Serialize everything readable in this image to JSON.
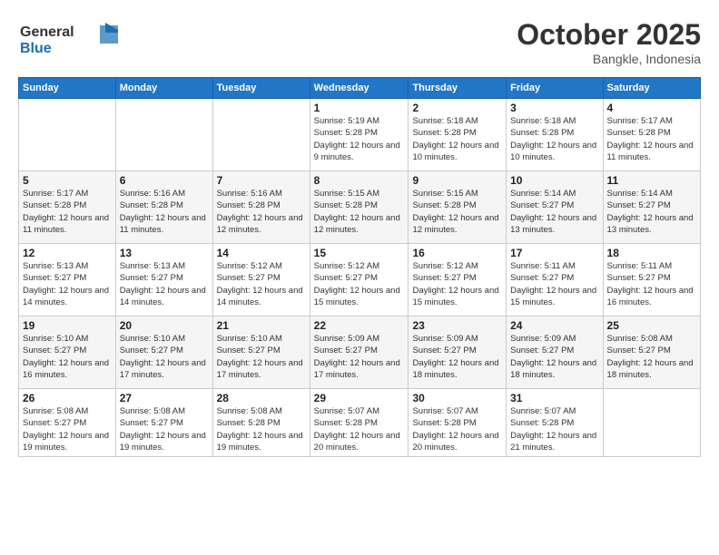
{
  "logo": {
    "line1": "General",
    "line2": "Blue"
  },
  "title": "October 2025",
  "location": "Bangkle, Indonesia",
  "days_header": [
    "Sunday",
    "Monday",
    "Tuesday",
    "Wednesday",
    "Thursday",
    "Friday",
    "Saturday"
  ],
  "weeks": [
    [
      {
        "day": "",
        "info": ""
      },
      {
        "day": "",
        "info": ""
      },
      {
        "day": "",
        "info": ""
      },
      {
        "day": "1",
        "info": "Sunrise: 5:19 AM\nSunset: 5:28 PM\nDaylight: 12 hours\nand 9 minutes."
      },
      {
        "day": "2",
        "info": "Sunrise: 5:18 AM\nSunset: 5:28 PM\nDaylight: 12 hours\nand 10 minutes."
      },
      {
        "day": "3",
        "info": "Sunrise: 5:18 AM\nSunset: 5:28 PM\nDaylight: 12 hours\nand 10 minutes."
      },
      {
        "day": "4",
        "info": "Sunrise: 5:17 AM\nSunset: 5:28 PM\nDaylight: 12 hours\nand 11 minutes."
      }
    ],
    [
      {
        "day": "5",
        "info": "Sunrise: 5:17 AM\nSunset: 5:28 PM\nDaylight: 12 hours\nand 11 minutes."
      },
      {
        "day": "6",
        "info": "Sunrise: 5:16 AM\nSunset: 5:28 PM\nDaylight: 12 hours\nand 11 minutes."
      },
      {
        "day": "7",
        "info": "Sunrise: 5:16 AM\nSunset: 5:28 PM\nDaylight: 12 hours\nand 12 minutes."
      },
      {
        "day": "8",
        "info": "Sunrise: 5:15 AM\nSunset: 5:28 PM\nDaylight: 12 hours\nand 12 minutes."
      },
      {
        "day": "9",
        "info": "Sunrise: 5:15 AM\nSunset: 5:28 PM\nDaylight: 12 hours\nand 12 minutes."
      },
      {
        "day": "10",
        "info": "Sunrise: 5:14 AM\nSunset: 5:27 PM\nDaylight: 12 hours\nand 13 minutes."
      },
      {
        "day": "11",
        "info": "Sunrise: 5:14 AM\nSunset: 5:27 PM\nDaylight: 12 hours\nand 13 minutes."
      }
    ],
    [
      {
        "day": "12",
        "info": "Sunrise: 5:13 AM\nSunset: 5:27 PM\nDaylight: 12 hours\nand 14 minutes."
      },
      {
        "day": "13",
        "info": "Sunrise: 5:13 AM\nSunset: 5:27 PM\nDaylight: 12 hours\nand 14 minutes."
      },
      {
        "day": "14",
        "info": "Sunrise: 5:12 AM\nSunset: 5:27 PM\nDaylight: 12 hours\nand 14 minutes."
      },
      {
        "day": "15",
        "info": "Sunrise: 5:12 AM\nSunset: 5:27 PM\nDaylight: 12 hours\nand 15 minutes."
      },
      {
        "day": "16",
        "info": "Sunrise: 5:12 AM\nSunset: 5:27 PM\nDaylight: 12 hours\nand 15 minutes."
      },
      {
        "day": "17",
        "info": "Sunrise: 5:11 AM\nSunset: 5:27 PM\nDaylight: 12 hours\nand 15 minutes."
      },
      {
        "day": "18",
        "info": "Sunrise: 5:11 AM\nSunset: 5:27 PM\nDaylight: 12 hours\nand 16 minutes."
      }
    ],
    [
      {
        "day": "19",
        "info": "Sunrise: 5:10 AM\nSunset: 5:27 PM\nDaylight: 12 hours\nand 16 minutes."
      },
      {
        "day": "20",
        "info": "Sunrise: 5:10 AM\nSunset: 5:27 PM\nDaylight: 12 hours\nand 17 minutes."
      },
      {
        "day": "21",
        "info": "Sunrise: 5:10 AM\nSunset: 5:27 PM\nDaylight: 12 hours\nand 17 minutes."
      },
      {
        "day": "22",
        "info": "Sunrise: 5:09 AM\nSunset: 5:27 PM\nDaylight: 12 hours\nand 17 minutes."
      },
      {
        "day": "23",
        "info": "Sunrise: 5:09 AM\nSunset: 5:27 PM\nDaylight: 12 hours\nand 18 minutes."
      },
      {
        "day": "24",
        "info": "Sunrise: 5:09 AM\nSunset: 5:27 PM\nDaylight: 12 hours\nand 18 minutes."
      },
      {
        "day": "25",
        "info": "Sunrise: 5:08 AM\nSunset: 5:27 PM\nDaylight: 12 hours\nand 18 minutes."
      }
    ],
    [
      {
        "day": "26",
        "info": "Sunrise: 5:08 AM\nSunset: 5:27 PM\nDaylight: 12 hours\nand 19 minutes."
      },
      {
        "day": "27",
        "info": "Sunrise: 5:08 AM\nSunset: 5:27 PM\nDaylight: 12 hours\nand 19 minutes."
      },
      {
        "day": "28",
        "info": "Sunrise: 5:08 AM\nSunset: 5:28 PM\nDaylight: 12 hours\nand 19 minutes."
      },
      {
        "day": "29",
        "info": "Sunrise: 5:07 AM\nSunset: 5:28 PM\nDaylight: 12 hours\nand 20 minutes."
      },
      {
        "day": "30",
        "info": "Sunrise: 5:07 AM\nSunset: 5:28 PM\nDaylight: 12 hours\nand 20 minutes."
      },
      {
        "day": "31",
        "info": "Sunrise: 5:07 AM\nSunset: 5:28 PM\nDaylight: 12 hours\nand 21 minutes."
      },
      {
        "day": "",
        "info": ""
      }
    ]
  ]
}
